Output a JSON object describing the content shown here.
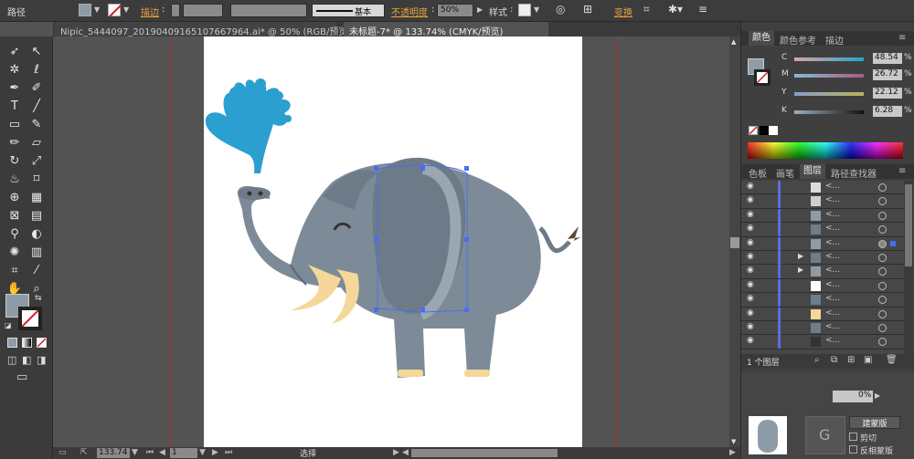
{
  "control_bar": {
    "object_label": "路径",
    "stroke_label": "描边",
    "brush_label": "基本",
    "opacity_label": "不透明度",
    "opacity_value": "50%",
    "style_label": "样式",
    "transform_label": "变换"
  },
  "tabs": [
    {
      "label": "Nipic_5444097_20190409165107667964.ai* @ 50% (RGB/预览)",
      "active": false
    },
    {
      "label": "未标题-7* @ 133.74% (CMYK/预览)",
      "active": true
    }
  ],
  "status": {
    "zoom": "133.74",
    "page": "1",
    "mode": "选择"
  },
  "color_panel": {
    "tabs": [
      "颜色",
      "颜色参考",
      "描边"
    ],
    "channels": [
      {
        "label": "C",
        "value": "48.54",
        "unit": "%"
      },
      {
        "label": "M",
        "value": "26.72",
        "unit": "%"
      },
      {
        "label": "Y",
        "value": "22.12",
        "unit": "%"
      },
      {
        "label": "K",
        "value": "6.28",
        "unit": "%"
      }
    ],
    "fill_color": "#8e9ca8"
  },
  "layers_panel": {
    "tabs": [
      "色板",
      "画笔",
      "图层",
      "路径查找器"
    ],
    "rows": [
      {
        "name": "<..."
      },
      {
        "name": "<..."
      },
      {
        "name": "<..."
      },
      {
        "name": "<..."
      },
      {
        "name": "<..."
      },
      {
        "name": "<..."
      },
      {
        "name": "<..."
      },
      {
        "name": "<..."
      },
      {
        "name": "<..."
      },
      {
        "name": "<..."
      },
      {
        "name": "<..."
      },
      {
        "name": "<..."
      }
    ],
    "footer": "1 个图层",
    "thumb_colors": [
      "#dcdcdc",
      "#cfcfcf",
      "#8e9ca8",
      "#6e7d8a",
      "#8e9ca8",
      "#6e7d8a",
      "#8e9ca8",
      "#fff",
      "#6e7d8a",
      "#f5d79a",
      "#6e7d8a",
      "#333"
    ]
  },
  "transparency_panel": {
    "opacity_value": "0%",
    "mask_button": "建蒙版",
    "clip_label": "剪切",
    "invert_label": "反相蒙版"
  },
  "colors": {
    "accent_orange": "#e8a33c",
    "selection_blue": "#4a6cf0",
    "guide_red": "#b03030",
    "elephant_gray": "#8e9ca8",
    "water_blue": "#2a9fd0",
    "tusk_cream": "#f5d79a"
  }
}
